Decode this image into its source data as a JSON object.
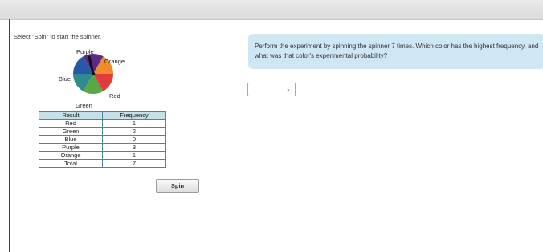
{
  "activity": {
    "instruction": "Select \"Spin\" to start the spinner.",
    "spinner": {
      "labels": {
        "purple": "Purple",
        "orange": "Orange",
        "blue": "Blue",
        "red": "Red",
        "green": "Green"
      },
      "colors": {
        "purple": "#5b2a86",
        "orange": "#f08a2e",
        "red": "#e23b3b",
        "green": "#5aa845",
        "teal": "#2e8c8c",
        "blue": "#2a58a8"
      }
    },
    "table": {
      "headers": [
        "Result",
        "Frequency"
      ],
      "rows": [
        {
          "result": "Red",
          "frequency": "1"
        },
        {
          "result": "Green",
          "frequency": "2"
        },
        {
          "result": "Blue",
          "frequency": "0"
        },
        {
          "result": "Purple",
          "frequency": "3"
        },
        {
          "result": "Orange",
          "frequency": "1"
        },
        {
          "result": "Total",
          "frequency": "7"
        }
      ]
    },
    "spin_button_label": "Spin"
  },
  "question": {
    "text": "Perform the experiment by spinning the spinner 7 times. Which color has the highest frequency, and what was that color's experimental probability?"
  },
  "answer": {
    "selected": ""
  }
}
